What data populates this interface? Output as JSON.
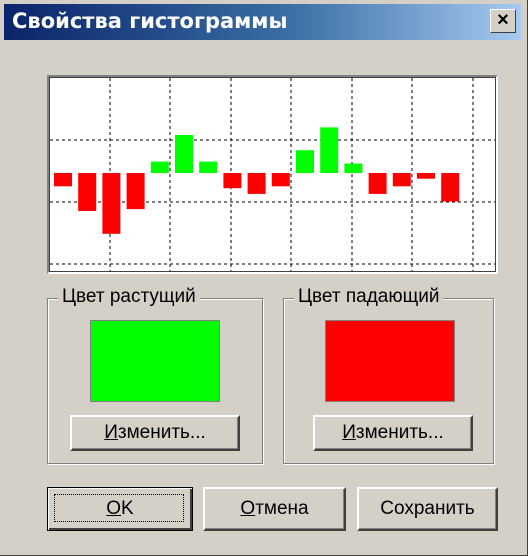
{
  "window": {
    "title": "Свойства гистограммы",
    "close_glyph": "×"
  },
  "preview": {
    "bars": [
      {
        "value": -0.35,
        "color": "#ff0000"
      },
      {
        "value": -1.0,
        "color": "#ff0000"
      },
      {
        "value": -1.6,
        "color": "#ff0000"
      },
      {
        "value": -0.95,
        "color": "#ff0000"
      },
      {
        "value": 0.3,
        "color": "#00ff00"
      },
      {
        "value": 1.0,
        "color": "#00ff00"
      },
      {
        "value": 0.3,
        "color": "#00ff00"
      },
      {
        "value": -0.4,
        "color": "#ff0000"
      },
      {
        "value": -0.55,
        "color": "#ff0000"
      },
      {
        "value": -0.35,
        "color": "#ff0000"
      },
      {
        "value": 0.6,
        "color": "#00ff00"
      },
      {
        "value": 1.2,
        "color": "#00ff00"
      },
      {
        "value": 0.25,
        "color": "#00ff00"
      },
      {
        "value": -0.55,
        "color": "#ff0000"
      },
      {
        "value": -0.35,
        "color": "#ff0000"
      },
      {
        "value": -0.15,
        "color": "#ff0000"
      },
      {
        "value": -0.75,
        "color": "#ff0000"
      }
    ]
  },
  "rising": {
    "label": "Цвет растущий",
    "color": "#00ff00",
    "change_prefix": "",
    "change_underlined": "И",
    "change_rest": "зменить..."
  },
  "falling": {
    "label": "Цвет падающий",
    "color": "#ff0000",
    "change_prefix": "",
    "change_underlined": "И",
    "change_rest": "зменить..."
  },
  "buttons": {
    "ok_underlined": "O",
    "ok_rest": "K",
    "cancel_underlined": "О",
    "cancel_rest": "тмена",
    "save": "Сохранить"
  }
}
